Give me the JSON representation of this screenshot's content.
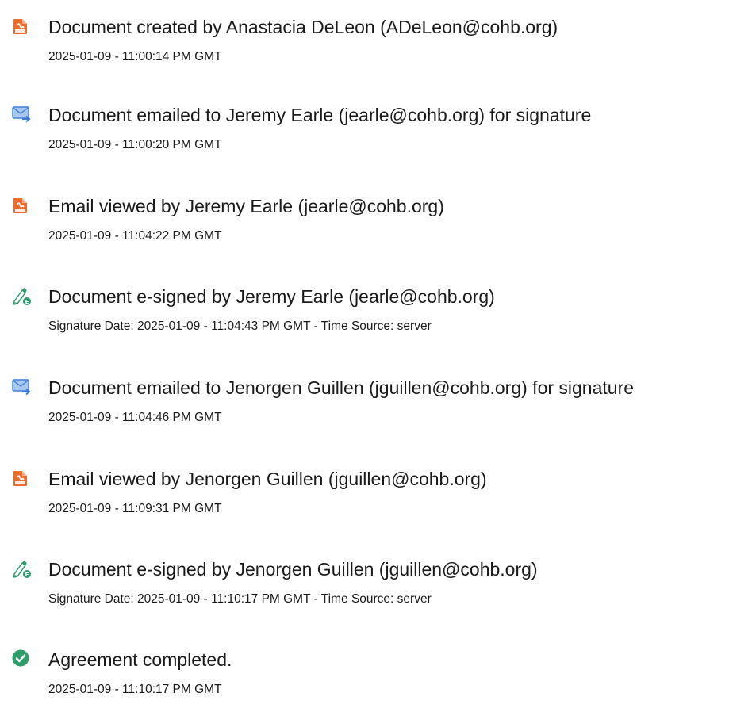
{
  "events": [
    {
      "icon": "document-created-icon",
      "title": "Document created by Anastacia DeLeon (ADeLeon@cohb.org)",
      "meta": "2025-01-09 - 11:00:14 PM GMT"
    },
    {
      "icon": "email-sent-icon",
      "title": "Document emailed to Jeremy Earle (jearle@cohb.org) for signature",
      "meta": "2025-01-09 - 11:00:20 PM GMT"
    },
    {
      "icon": "document-viewed-icon",
      "title": "Email viewed by Jeremy Earle (jearle@cohb.org)",
      "meta": "2025-01-09 - 11:04:22 PM GMT"
    },
    {
      "icon": "esign-pen-icon",
      "title": "Document e-signed by Jeremy Earle (jearle@cohb.org)",
      "meta": "Signature Date: 2025-01-09 - 11:04:43 PM GMT - Time Source: server"
    },
    {
      "icon": "email-sent-icon",
      "title": "Document emailed to Jenorgen Guillen (jguillen@cohb.org) for signature",
      "meta": "2025-01-09 - 11:04:46 PM GMT"
    },
    {
      "icon": "document-viewed-icon",
      "title": "Email viewed by Jenorgen Guillen (jguillen@cohb.org)",
      "meta": "2025-01-09 - 11:09:31 PM GMT"
    },
    {
      "icon": "esign-pen-icon",
      "title": "Document e-signed by Jenorgen Guillen (jguillen@cohb.org)",
      "meta": "Signature Date: 2025-01-09 - 11:10:17 PM GMT - Time Source: server"
    },
    {
      "icon": "checkmark-circle-icon",
      "title": "Agreement completed.",
      "meta": "2025-01-09 - 11:10:17 PM GMT"
    }
  ],
  "colors": {
    "document_icon": "#f06a2c",
    "email_icon": "#3d7fd6",
    "email_icon_light": "#a9c8ee",
    "pen_icon": "#2f9a6e",
    "complete_icon": "#2e9e6a",
    "text": "#1a1a1a"
  }
}
